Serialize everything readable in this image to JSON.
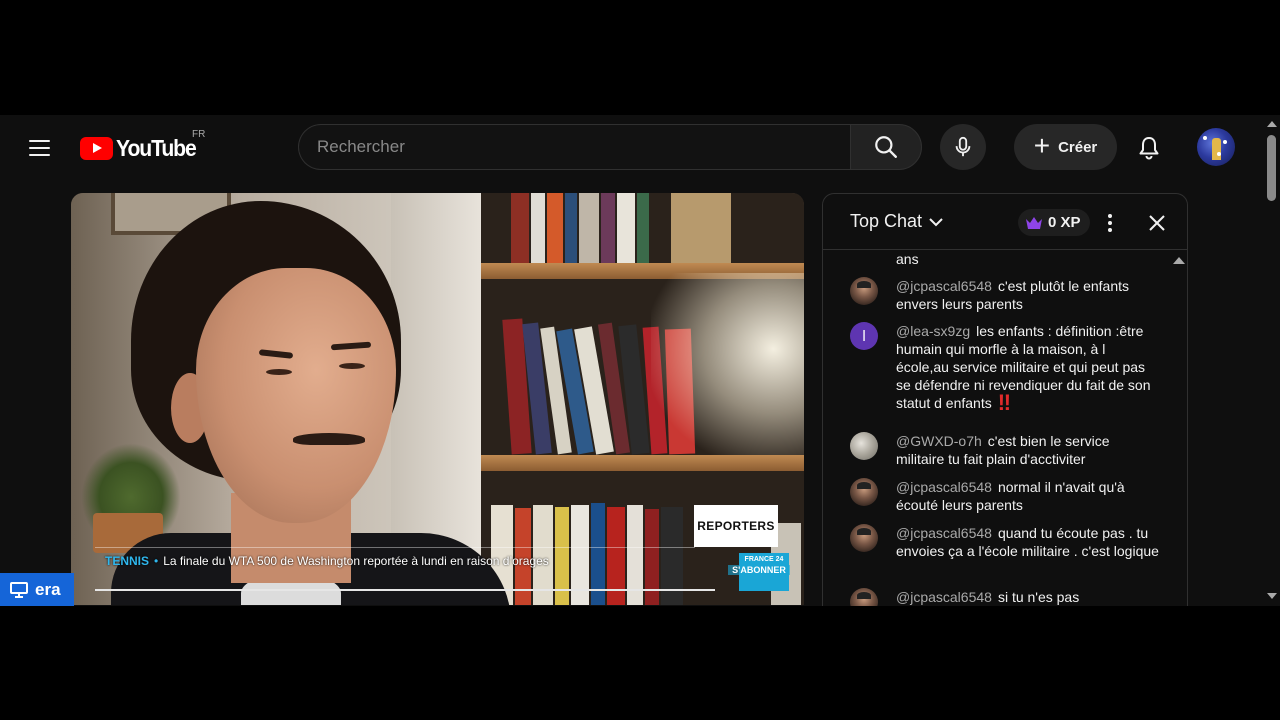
{
  "header": {
    "logo_text": "YouTube",
    "region": "FR",
    "search_placeholder": "Rechercher",
    "create_label": "Créer"
  },
  "video": {
    "ticker_category": "TENNIS",
    "ticker_text": "La finale du WTA 500 de Washington reportée à lundi en raison d’orages",
    "show_badge": "REPORTERS",
    "channel_badge_top": "FRANCE 24",
    "channel_badge_sub": "S'ABONNER"
  },
  "overlay": {
    "era_label": "era"
  },
  "chat": {
    "mode_label": "Top Chat",
    "xp_label": "0 XP",
    "partial_text": "ans",
    "messages": [
      {
        "author": "@jcpascal6548",
        "text": "c'est plutôt le enfants envers leurs parents",
        "avatar": "photo"
      },
      {
        "author": "@lea-sx9zg",
        "text": "les enfants : définition :être humain qui morfle à la maison, à l école,au service militaire et qui peut pas se défendre ni revendiquer du fait de son statut d enfants",
        "avatar_letter": "l",
        "emoji": "‼"
      },
      {
        "author": "@GWXD-o7h",
        "text": "c'est bien le service militaire tu fait plain d'acctiviter",
        "avatar": "gray"
      },
      {
        "author": "@jcpascal6548",
        "text": "normal il n'avait qu'à écouté leurs parents",
        "avatar": "photo"
      },
      {
        "author": "@jcpascal6548",
        "text": "quand tu écoute pas . tu envoies ça a l'école militaire . c'est logique",
        "avatar": "photo"
      },
      {
        "author": "@jcpascal6548",
        "text": "si tu n'es pas",
        "avatar": "photo"
      }
    ]
  },
  "colors": {
    "background": "#0f0f0f",
    "brand_red": "#ff0000",
    "ticker_accent": "#2fb7ee",
    "era_badge": "#1565d8",
    "author_gray": "#aaaaaa"
  },
  "icons": [
    "menu-icon",
    "youtube-logo-icon",
    "search-icon",
    "mic-icon",
    "plus-icon",
    "bell-icon",
    "chevron-down-icon",
    "crown-icon",
    "more-vert-icon",
    "close-icon",
    "monitor-icon"
  ]
}
